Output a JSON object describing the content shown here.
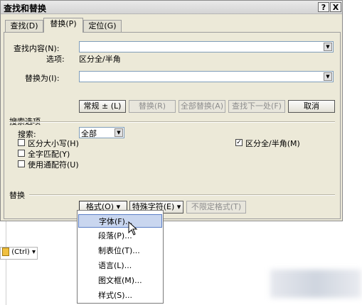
{
  "window": {
    "title": "查找和替换",
    "help_btn": "?",
    "close_btn": "X"
  },
  "tabs": [
    {
      "label": "查找(D)"
    },
    {
      "label": "替换(P)"
    },
    {
      "label": "定位(G)"
    }
  ],
  "find": {
    "label": "查找内容(N):",
    "value": "",
    "options_label": "选项:",
    "options_value": "区分全/半角"
  },
  "replace": {
    "label": "替换为(I):",
    "value": ""
  },
  "buttons": {
    "normal": "常规 ± (L)",
    "replace": "替换(R)",
    "replace_all": "全部替换(A)",
    "find_next": "查找下一处(F)",
    "cancel": "取消"
  },
  "search_options": {
    "heading": "搜索选项",
    "search_label": "搜索:",
    "search_value": "全部",
    "checkboxes": [
      {
        "label": "区分大小写(H)",
        "checked": false
      },
      {
        "label": "全字匹配(Y)",
        "checked": false
      },
      {
        "label": "使用通配符(U)",
        "checked": false
      }
    ],
    "right_checkbox": {
      "label": "区分全/半角(M)",
      "checked": true
    }
  },
  "replace_section": {
    "heading": "替换",
    "format_btn": "格式(O) ▾",
    "special_btn": "特殊字符(E) ▾",
    "no_format_btn": "不限定格式(T)"
  },
  "format_menu": [
    "字体(F)...",
    "段落(P)...",
    "制表位(T)...",
    "语言(L)...",
    "图文框(M)...",
    "样式(S)..."
  ],
  "background": {
    "paste_tag": "(Ctrl)"
  }
}
